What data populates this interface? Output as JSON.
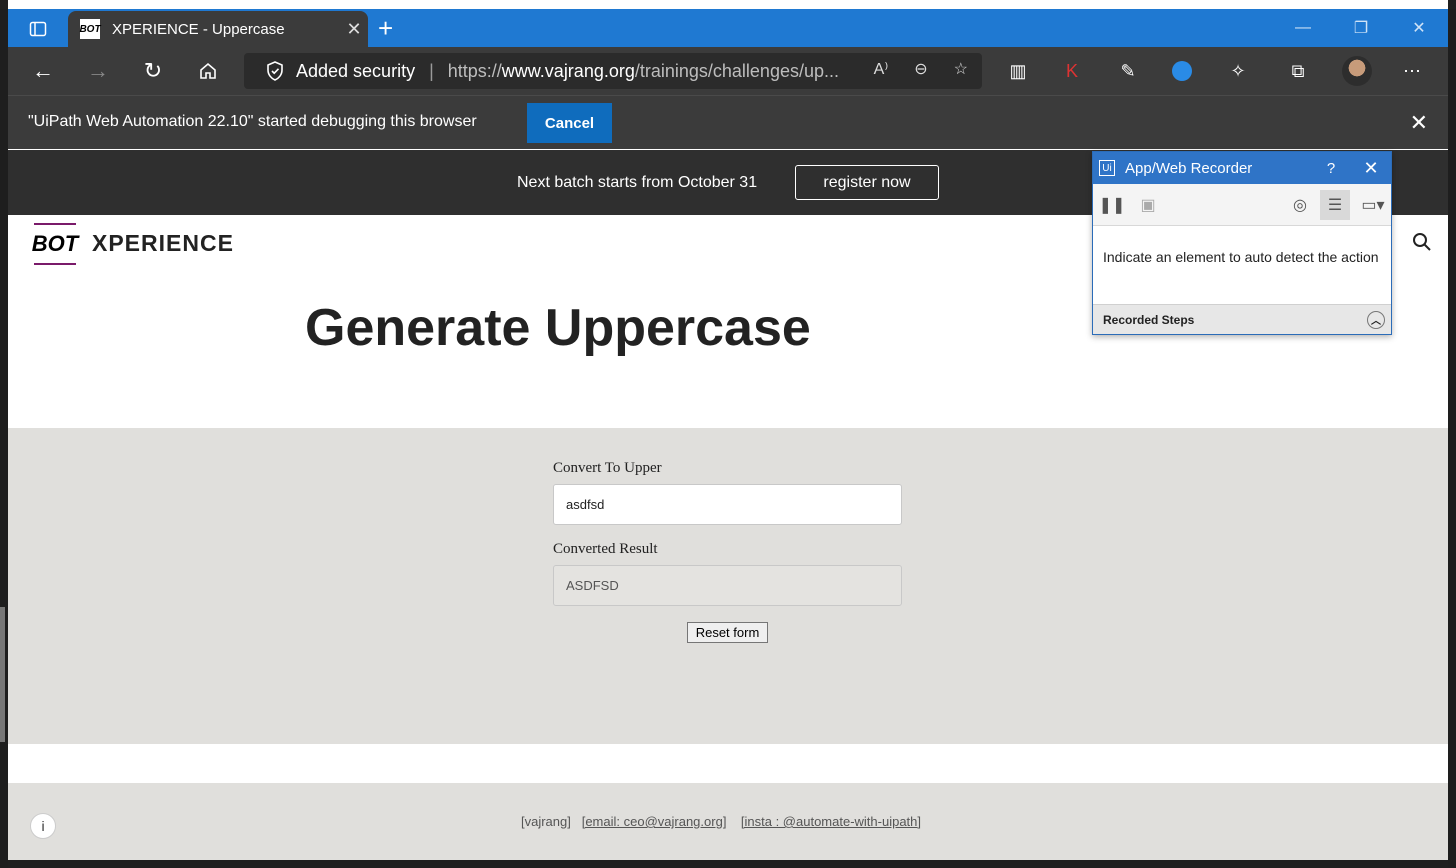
{
  "browser": {
    "tab_title": "XPERIENCE - Uppercase",
    "tab_favicon_text": "BOT",
    "new_tab": "+",
    "security_label": "Added security",
    "url_prefix": "https://",
    "url_domain": "www.vajrang.org",
    "url_path": "/trainings/challenges/up...",
    "infobar_message": "\"UiPath Web Automation 22.10\" started debugging this browser",
    "infobar_cancel": "Cancel"
  },
  "site": {
    "banner_text": "Next batch starts from October 31",
    "banner_button": "register now",
    "logo_text": "BOT",
    "brand": "XPERIENCE",
    "heading": "Generate Uppercase",
    "form": {
      "input_label": "Convert To Upper",
      "input_value": "asdfsd",
      "result_label": "Converted Result",
      "result_value": "ASDFSD",
      "reset_label": "Reset form"
    },
    "footer": {
      "link1": "[vajrang]",
      "link2": "[email: ceo@vajrang.org]",
      "link3": "[insta : @automate-with-uipath]"
    }
  },
  "recorder": {
    "logo": "Ui",
    "title": "App/Web Recorder",
    "help": "?",
    "close": "✕",
    "message": "Indicate an element to auto detect the action",
    "steps_label": "Recorded Steps"
  },
  "icons": [
    "tab-actions-icon",
    "close-icon",
    "back-icon",
    "forward-icon",
    "refresh-icon",
    "home-icon",
    "shield-icon",
    "read-aloud-icon",
    "zoom-icon",
    "favorites-icon",
    "extensions-icon",
    "collections-icon",
    "more-icon",
    "search-icon",
    "info-icon",
    "pause-icon",
    "save-icon",
    "target-icon",
    "steps-icon",
    "screen-icon",
    "chevron-up-icon"
  ]
}
